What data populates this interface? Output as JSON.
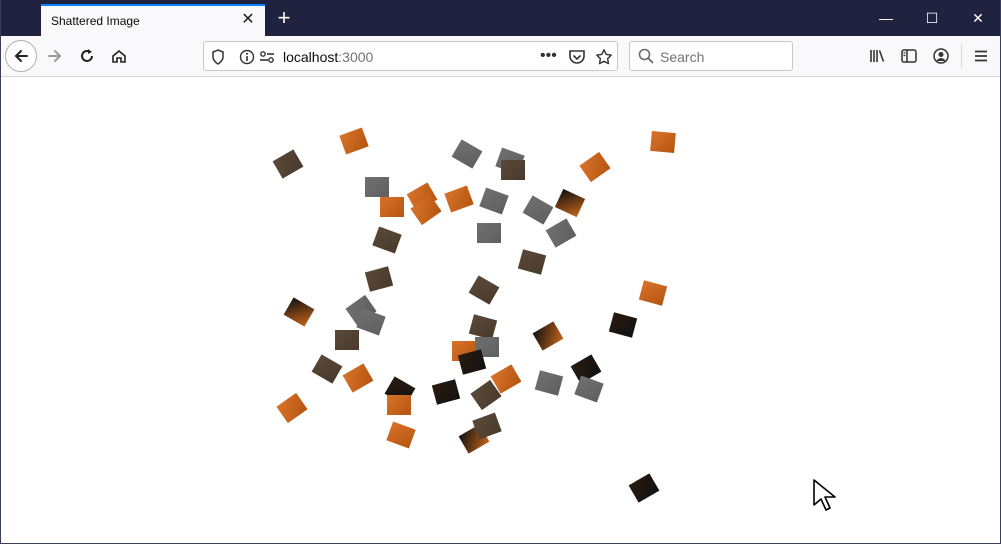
{
  "browser": {
    "tab_title": "Shattered Image",
    "url_host": "localhost",
    "url_port": ":3000",
    "search_placeholder": "Search"
  },
  "icons": {
    "tab_close": "close-icon",
    "new_tab": "plus-icon",
    "minimize": "minimize-icon",
    "maximize": "maximize-icon",
    "close_window": "close-icon",
    "back": "arrow-left-icon",
    "forward": "arrow-right-icon",
    "reload": "reload-icon",
    "home": "home-icon",
    "tracking_protection": "shield-icon",
    "site_info": "info-icon",
    "permissions": "permissions-icon",
    "page_actions": "ellipsis-icon",
    "pocket": "pocket-icon",
    "bookmark": "star-icon",
    "search": "search-icon",
    "library": "library-icon",
    "sidebar": "sidebar-icon",
    "account": "account-icon",
    "menu": "hamburger-menu-icon",
    "pointer": "mouse-pointer-icon"
  },
  "colors": {
    "titlebar": "#202340",
    "tab_accent": "#0a84ff",
    "shard_orange": "#d9732a",
    "shard_gray": "#5f5f5f",
    "shard_brown": "#4a3a2c",
    "shard_dark": "#111111"
  }
}
